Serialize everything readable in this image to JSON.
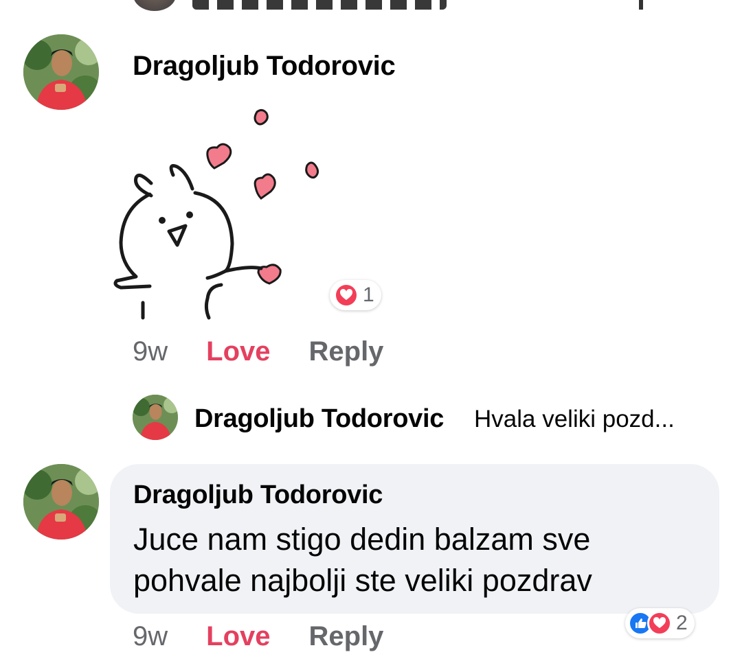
{
  "comment1": {
    "author": "Dragoljub Todorovic",
    "reactions": {
      "types": [
        "love-icon"
      ],
      "count": "1"
    },
    "actions": {
      "time": "9w",
      "love": "Love",
      "reply": "Reply"
    }
  },
  "reply_preview": {
    "author": "Dragoljub Todorovic",
    "text": "Hvala veliki pozd..."
  },
  "comment2": {
    "author": "Dragoljub Todorovic",
    "text": "Juce nam stigo dedin balzam sve pohvale najbolji ste veliki pozdrav",
    "reactions": {
      "types": [
        "like-icon",
        "love-icon"
      ],
      "count": "2"
    },
    "actions": {
      "time": "9w",
      "love": "Love",
      "reply": "Reply"
    }
  },
  "colors": {
    "love_accent": "#e4405f",
    "bubble_bg": "#f0f2f5",
    "secondary_text": "#65676b",
    "like_blue": "#1877f2",
    "love_red": "#f33e58"
  }
}
